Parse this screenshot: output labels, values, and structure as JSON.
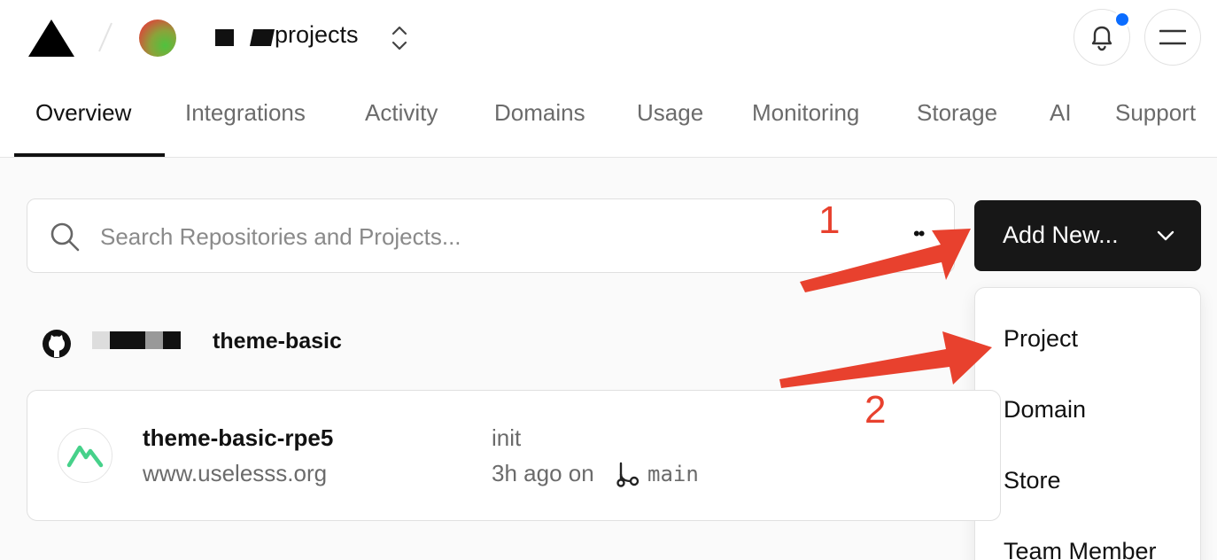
{
  "header": {
    "team_name": "projects",
    "notifications_badge_color": "#0a6cff"
  },
  "tabs": [
    {
      "label": "Overview",
      "active": true
    },
    {
      "label": "Integrations"
    },
    {
      "label": "Activity"
    },
    {
      "label": "Domains"
    },
    {
      "label": "Usage"
    },
    {
      "label": "Monitoring"
    },
    {
      "label": "Storage"
    },
    {
      "label": "AI"
    },
    {
      "label": "Support"
    }
  ],
  "search": {
    "placeholder": "Search Repositories and Projects...",
    "value": ""
  },
  "add_new": {
    "label": "Add New..."
  },
  "dropdown": {
    "items": [
      "Project",
      "Domain",
      "Store",
      "Team Member"
    ]
  },
  "repo_group": {
    "name": "theme-basic"
  },
  "project_card": {
    "name": "theme-basic-rpe5",
    "url": "www.uselesss.org",
    "commit_message": "init",
    "commit_time": "3h ago on",
    "branch": "main"
  },
  "annotations": {
    "step1": "1",
    "step2": "2",
    "color": "#e8412e"
  }
}
